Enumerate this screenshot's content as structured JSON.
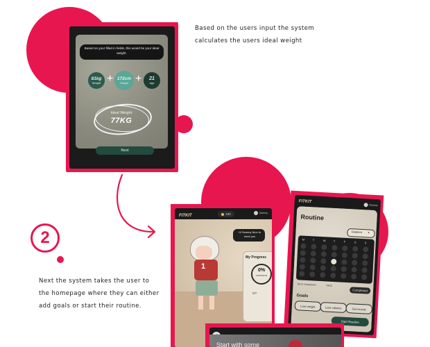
{
  "step1": {
    "caption_line1": "Based on the users input the system",
    "caption_line2": "calculates the users ideal weight",
    "screen": {
      "message": "Based on your filled in fields, this would be your ideal weight.",
      "weight_value": "81kg",
      "weight_label": "Weight",
      "height_value": "172cm",
      "height_label": "Height",
      "age_value": "21",
      "age_label": "Age",
      "plus_symbol": "+",
      "ideal_label": "Ideal Weight",
      "ideal_value": "77KG",
      "next_button": "Next"
    }
  },
  "step2": {
    "number": "2",
    "caption_line1": "Next the system takes the user to",
    "caption_line2": "the homepage where they can either",
    "caption_line3": "add goals or start their routine.",
    "home_screen": {
      "logo": "FITKIT",
      "coins": "100",
      "user": "Sammy",
      "speech": "Hi Sammy Nice to meet you",
      "progress_title": "My Progress",
      "progress_value": "0%",
      "progress_label": "COMPLETE",
      "fraction": "0/7",
      "shirt_number": "1"
    },
    "routine_screen": {
      "logo": "FITKIT",
      "user": "Routine",
      "title": "Routine",
      "dropdown": "Gradient",
      "day_headers": [
        "M",
        "T",
        "W",
        "T",
        "F",
        "S",
        "S"
      ],
      "completion_label": "Set & Completion",
      "date_label": "04/22",
      "complete_button": "Completed",
      "goals_title": "Goals",
      "goal_buttons": [
        "Lose weight",
        "Lose calories",
        "Get muscle"
      ],
      "start_button": "Start Routine"
    },
    "bottom_screen": {
      "back_symbol": "‹",
      "heading": "Start with some"
    }
  },
  "colors": {
    "accent": "#e8164f",
    "dark_green": "#234a3f",
    "teal": "#5aa796"
  }
}
